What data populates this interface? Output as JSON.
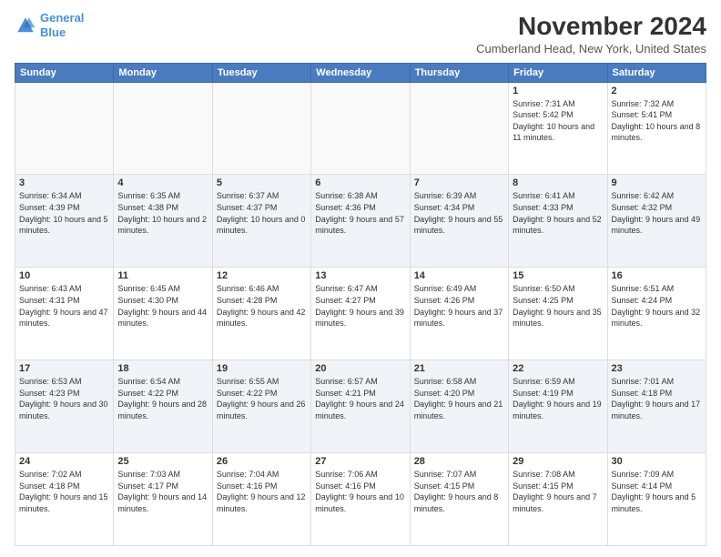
{
  "header": {
    "logo_line1": "General",
    "logo_line2": "Blue",
    "title": "November 2024",
    "subtitle": "Cumberland Head, New York, United States"
  },
  "days_of_week": [
    "Sunday",
    "Monday",
    "Tuesday",
    "Wednesday",
    "Thursday",
    "Friday",
    "Saturday"
  ],
  "weeks": [
    [
      {
        "day": "",
        "info": ""
      },
      {
        "day": "",
        "info": ""
      },
      {
        "day": "",
        "info": ""
      },
      {
        "day": "",
        "info": ""
      },
      {
        "day": "",
        "info": ""
      },
      {
        "day": "1",
        "info": "Sunrise: 7:31 AM\nSunset: 5:42 PM\nDaylight: 10 hours and 11 minutes."
      },
      {
        "day": "2",
        "info": "Sunrise: 7:32 AM\nSunset: 5:41 PM\nDaylight: 10 hours and 8 minutes."
      }
    ],
    [
      {
        "day": "3",
        "info": "Sunrise: 6:34 AM\nSunset: 4:39 PM\nDaylight: 10 hours and 5 minutes."
      },
      {
        "day": "4",
        "info": "Sunrise: 6:35 AM\nSunset: 4:38 PM\nDaylight: 10 hours and 2 minutes."
      },
      {
        "day": "5",
        "info": "Sunrise: 6:37 AM\nSunset: 4:37 PM\nDaylight: 10 hours and 0 minutes."
      },
      {
        "day": "6",
        "info": "Sunrise: 6:38 AM\nSunset: 4:36 PM\nDaylight: 9 hours and 57 minutes."
      },
      {
        "day": "7",
        "info": "Sunrise: 6:39 AM\nSunset: 4:34 PM\nDaylight: 9 hours and 55 minutes."
      },
      {
        "day": "8",
        "info": "Sunrise: 6:41 AM\nSunset: 4:33 PM\nDaylight: 9 hours and 52 minutes."
      },
      {
        "day": "9",
        "info": "Sunrise: 6:42 AM\nSunset: 4:32 PM\nDaylight: 9 hours and 49 minutes."
      }
    ],
    [
      {
        "day": "10",
        "info": "Sunrise: 6:43 AM\nSunset: 4:31 PM\nDaylight: 9 hours and 47 minutes."
      },
      {
        "day": "11",
        "info": "Sunrise: 6:45 AM\nSunset: 4:30 PM\nDaylight: 9 hours and 44 minutes."
      },
      {
        "day": "12",
        "info": "Sunrise: 6:46 AM\nSunset: 4:28 PM\nDaylight: 9 hours and 42 minutes."
      },
      {
        "day": "13",
        "info": "Sunrise: 6:47 AM\nSunset: 4:27 PM\nDaylight: 9 hours and 39 minutes."
      },
      {
        "day": "14",
        "info": "Sunrise: 6:49 AM\nSunset: 4:26 PM\nDaylight: 9 hours and 37 minutes."
      },
      {
        "day": "15",
        "info": "Sunrise: 6:50 AM\nSunset: 4:25 PM\nDaylight: 9 hours and 35 minutes."
      },
      {
        "day": "16",
        "info": "Sunrise: 6:51 AM\nSunset: 4:24 PM\nDaylight: 9 hours and 32 minutes."
      }
    ],
    [
      {
        "day": "17",
        "info": "Sunrise: 6:53 AM\nSunset: 4:23 PM\nDaylight: 9 hours and 30 minutes."
      },
      {
        "day": "18",
        "info": "Sunrise: 6:54 AM\nSunset: 4:22 PM\nDaylight: 9 hours and 28 minutes."
      },
      {
        "day": "19",
        "info": "Sunrise: 6:55 AM\nSunset: 4:22 PM\nDaylight: 9 hours and 26 minutes."
      },
      {
        "day": "20",
        "info": "Sunrise: 6:57 AM\nSunset: 4:21 PM\nDaylight: 9 hours and 24 minutes."
      },
      {
        "day": "21",
        "info": "Sunrise: 6:58 AM\nSunset: 4:20 PM\nDaylight: 9 hours and 21 minutes."
      },
      {
        "day": "22",
        "info": "Sunrise: 6:59 AM\nSunset: 4:19 PM\nDaylight: 9 hours and 19 minutes."
      },
      {
        "day": "23",
        "info": "Sunrise: 7:01 AM\nSunset: 4:18 PM\nDaylight: 9 hours and 17 minutes."
      }
    ],
    [
      {
        "day": "24",
        "info": "Sunrise: 7:02 AM\nSunset: 4:18 PM\nDaylight: 9 hours and 15 minutes."
      },
      {
        "day": "25",
        "info": "Sunrise: 7:03 AM\nSunset: 4:17 PM\nDaylight: 9 hours and 14 minutes."
      },
      {
        "day": "26",
        "info": "Sunrise: 7:04 AM\nSunset: 4:16 PM\nDaylight: 9 hours and 12 minutes."
      },
      {
        "day": "27",
        "info": "Sunrise: 7:06 AM\nSunset: 4:16 PM\nDaylight: 9 hours and 10 minutes."
      },
      {
        "day": "28",
        "info": "Sunrise: 7:07 AM\nSunset: 4:15 PM\nDaylight: 9 hours and 8 minutes."
      },
      {
        "day": "29",
        "info": "Sunrise: 7:08 AM\nSunset: 4:15 PM\nDaylight: 9 hours and 7 minutes."
      },
      {
        "day": "30",
        "info": "Sunrise: 7:09 AM\nSunset: 4:14 PM\nDaylight: 9 hours and 5 minutes."
      }
    ]
  ]
}
